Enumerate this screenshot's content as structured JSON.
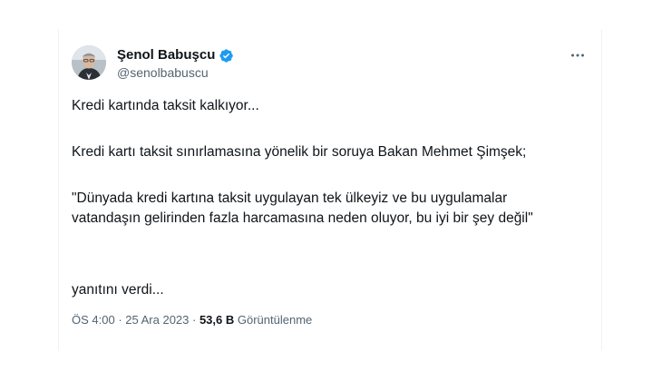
{
  "tweet": {
    "author": {
      "display_name": "Şenol Babuşcu",
      "handle": "@senolbabuscu",
      "verified": true,
      "verified_color": "#1d9bf0"
    },
    "text": {
      "line1": "Kredi kartında taksit kalkıyor...",
      "line2": "Kredi kartı taksit sınırlamasına yönelik bir soruya Bakan Mehmet Şimşek;",
      "line3": " \"Dünyada kredi kartına taksit uygulayan tek ülkeyiz ve bu uygulamalar vatandaşın gelirinden fazla harcamasına neden oluyor, bu iyi bir şey değil\"",
      "line4": "yanıtını verdi..."
    },
    "meta": {
      "time": "ÖS 4:00",
      "separator": " · ",
      "date": "25 Ara 2023",
      "views_count": "53,6 B",
      "views_label": "Görüntülenme"
    },
    "icons": {
      "more": "more-dots-icon",
      "verified": "verified-badge-icon",
      "avatar": "profile-avatar"
    }
  }
}
